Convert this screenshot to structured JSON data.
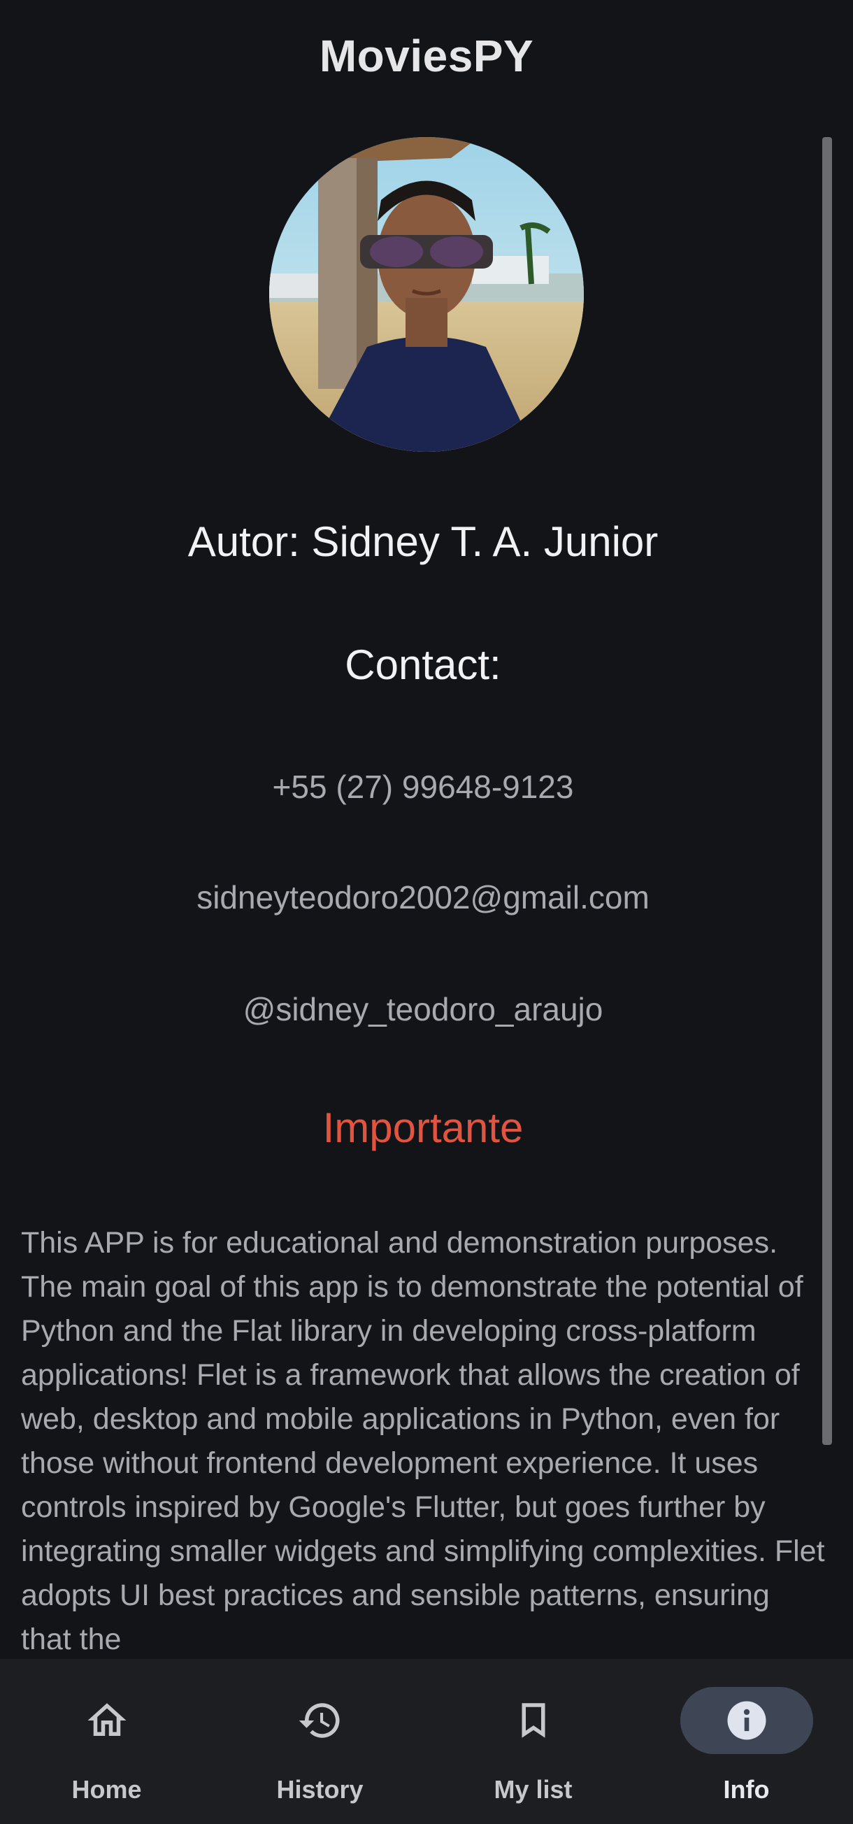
{
  "app": {
    "title": "MoviesPY"
  },
  "profile": {
    "author": "Autor: Sidney T. A. Junior",
    "contact_title": "Contact:",
    "phone": "+55 (27) 99648-9123",
    "email": "sidneyteodoro2002@gmail.com",
    "handle": "@sidney_teodoro_araujo",
    "important_title": "Importante",
    "description": "This APP is for educational and demonstration purposes. The main goal of this app is to demonstrate the potential of Python and the Flat library in developing cross-platform applications! Flet is a framework that allows the creation of web, desktop and mobile applications in Python, even for those without frontend development experience. It uses controls inspired by Google's Flutter, but goes further by integrating smaller widgets and simplifying complexities. Flet adopts UI best practices and sensible patterns, ensuring that the"
  },
  "nav": {
    "items": [
      {
        "label": "Home",
        "icon": "home-icon",
        "active": false
      },
      {
        "label": "History",
        "icon": "history-icon",
        "active": false
      },
      {
        "label": "My list",
        "icon": "bookmark-icon",
        "active": false
      },
      {
        "label": "Info",
        "icon": "info-icon",
        "active": true
      }
    ]
  },
  "colors": {
    "background": "#131417",
    "navbar": "#1d1e22",
    "accent_red": "#e2543f",
    "active_pill": "#3e4655"
  }
}
